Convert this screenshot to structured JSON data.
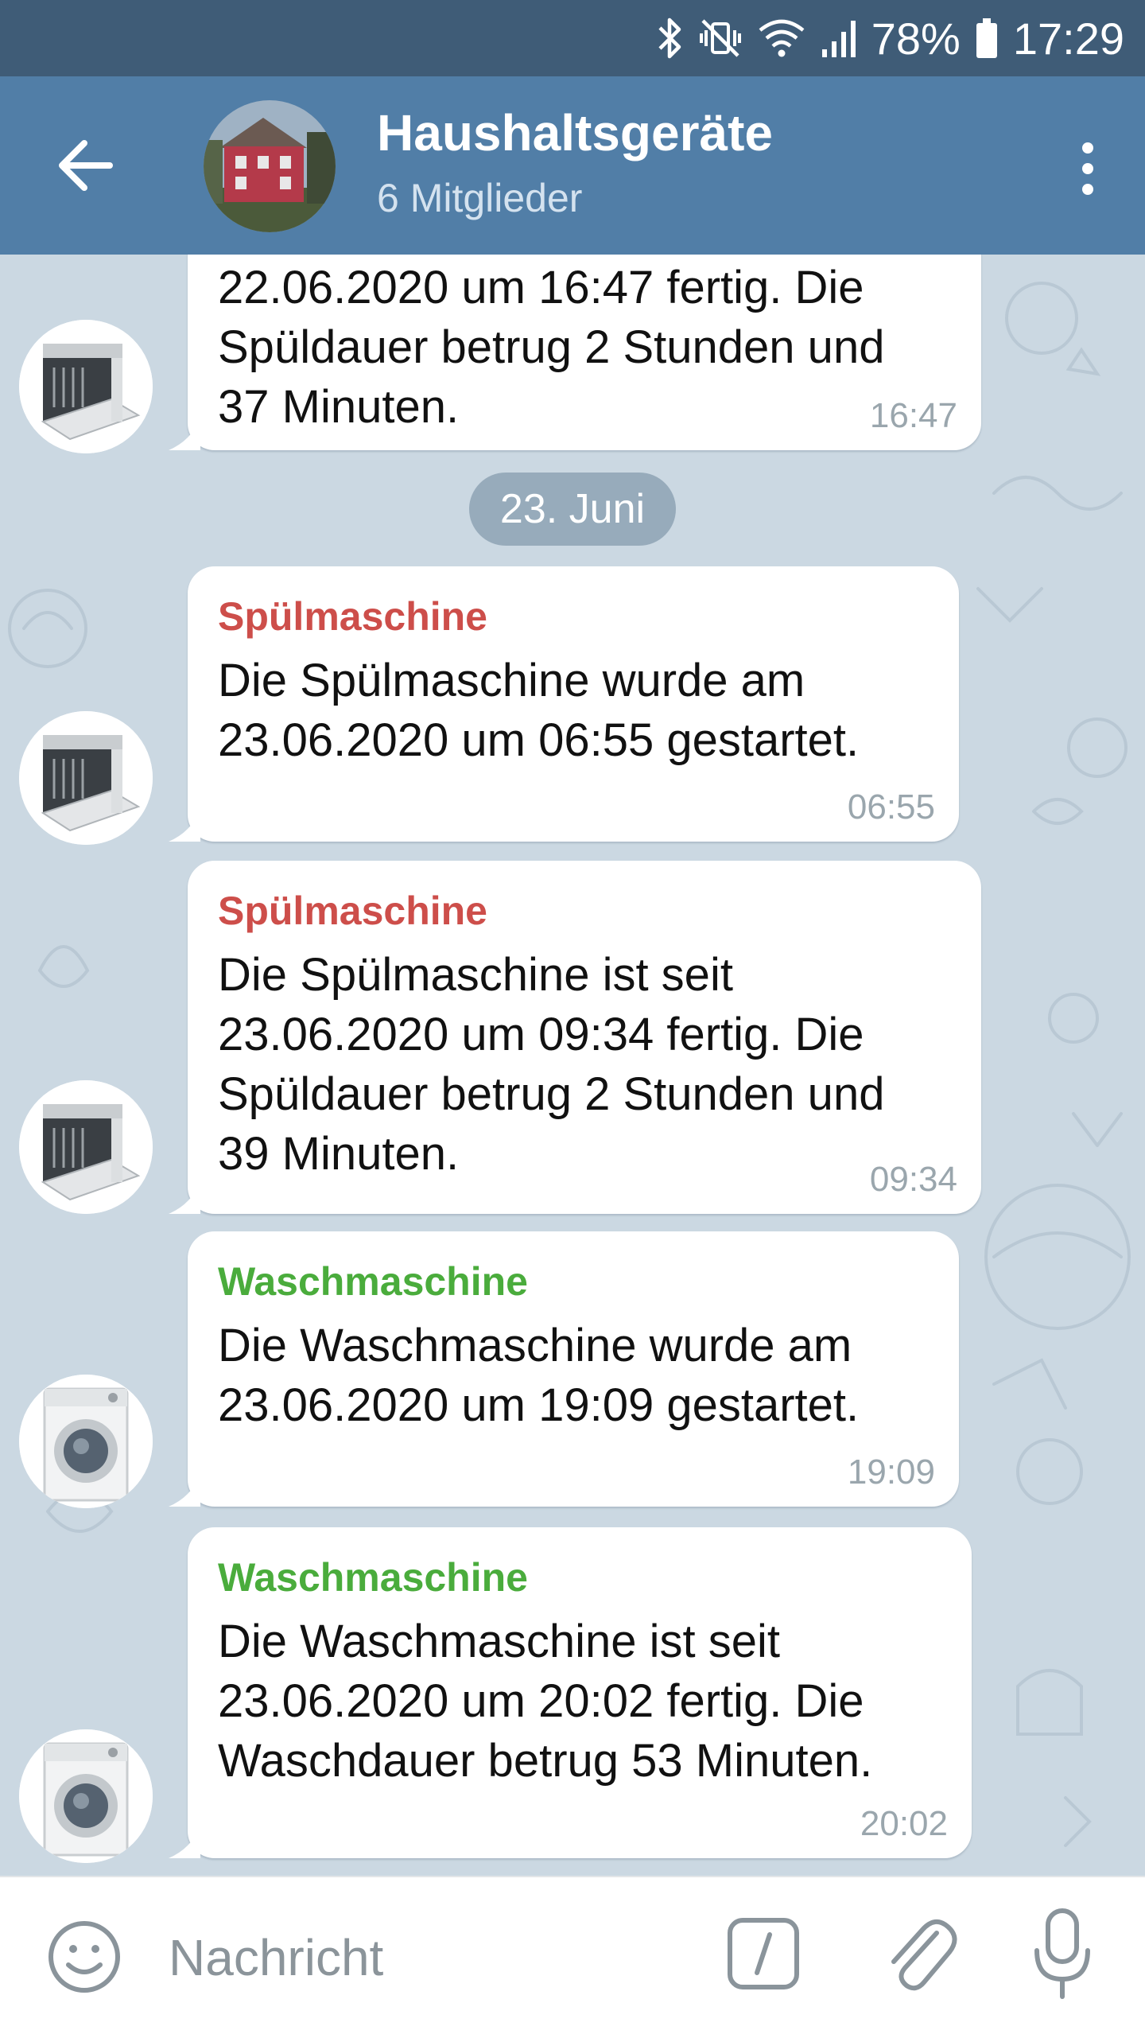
{
  "status_bar": {
    "battery": "78%",
    "time": "17:29",
    "icons": [
      "bluetooth-icon",
      "vibrate-mute-icon",
      "wifi-icon",
      "signal-icon",
      "battery-icon"
    ]
  },
  "header": {
    "title": "Haushaltsgeräte",
    "subtitle": "6 Mitglieder",
    "back_icon": "arrow-left-icon",
    "menu_icon": "more-vertical-icon"
  },
  "chat": {
    "date_separator": "23. Juni",
    "messages": [
      {
        "sender": "",
        "text": "22.06.2020 um 16:47 fertig. Die\nSpüldauer betrug 2 Stunden und\n37 Minuten.",
        "time": "16:47",
        "avatar": "dishwasher-avatar"
      },
      {
        "sender": "Spülmaschine",
        "text": "Die Spülmaschine wurde am\n23.06.2020 um 06:55 gestartet.",
        "time": "06:55",
        "avatar": "dishwasher-avatar"
      },
      {
        "sender": "Spülmaschine",
        "text": "Die Spülmaschine ist seit\n23.06.2020 um 09:34 fertig. Die\nSpüldauer betrug 2 Stunden und\n39 Minuten.",
        "time": "09:34",
        "avatar": "dishwasher-avatar"
      },
      {
        "sender": "Waschmaschine",
        "text": "Die Waschmaschine wurde am\n23.06.2020 um 19:09 gestartet.",
        "time": "19:09",
        "avatar": "washing-machine-avatar"
      },
      {
        "sender": "Waschmaschine",
        "text": "Die Waschmaschine ist seit\n23.06.2020 um 20:02 fertig. Die\nWaschdauer betrug 53 Minuten.",
        "time": "20:02",
        "avatar": "washing-machine-avatar"
      }
    ]
  },
  "input_bar": {
    "placeholder": "Nachricht",
    "icons": [
      "emoji-icon",
      "bot-command-icon",
      "paperclip-icon",
      "microphone-icon"
    ]
  },
  "colors": {
    "status_bar": "#3f5c77",
    "header": "#517ea7",
    "chat_background": "#cbd8e2",
    "sender_dishwasher": "#cd4e4a",
    "sender_washer": "#4aac3c",
    "time_text": "#9aa6ad"
  }
}
